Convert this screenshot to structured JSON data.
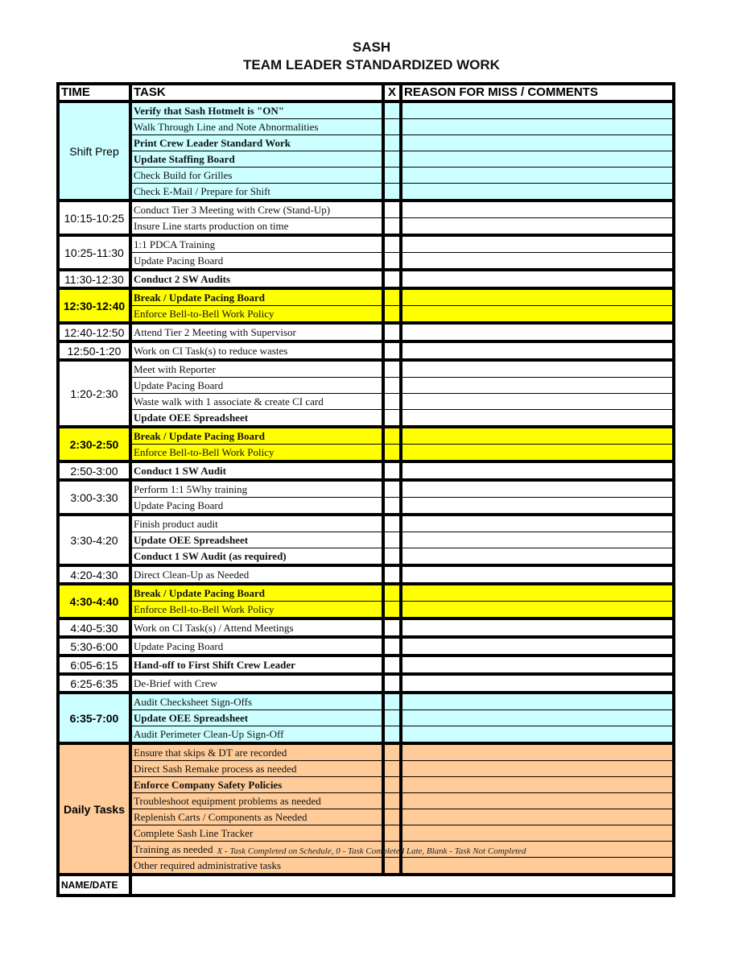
{
  "document": {
    "title": "SASH",
    "subtitle": "TEAM LEADER STANDARDIZED WORK"
  },
  "colors": {
    "cyan": "#ccffff",
    "yellow": "#ffff00",
    "orange": "#ffcc99",
    "white": "#ffffff"
  },
  "headers": {
    "time": "TIME",
    "task": "TASK",
    "x": "X",
    "comments": "REASON FOR MISS / COMMENTS"
  },
  "groups": [
    {
      "time": "Shift Prep",
      "color": "cyan",
      "time_bold": false,
      "tasks": [
        {
          "text": "Verify that Sash Hotmelt is \"ON\"",
          "bold": true
        },
        {
          "text": "Walk Through Line and Note Abnormalities",
          "bold": false
        },
        {
          "text": "Print Crew Leader Standard Work",
          "bold": true
        },
        {
          "text": "Update Staffing Board",
          "bold": true
        },
        {
          "text": "Check Build for Grilles",
          "bold": false
        },
        {
          "text": "Check E-Mail / Prepare for Shift",
          "bold": false
        }
      ]
    },
    {
      "time": "10:15-10:25",
      "color": "white",
      "time_bold": false,
      "tasks": [
        {
          "text": "Conduct Tier 3 Meeting with Crew (Stand-Up)",
          "bold": false
        },
        {
          "text": "Insure Line starts production on time",
          "bold": false
        }
      ]
    },
    {
      "time": "10:25-11:30",
      "color": "white",
      "time_bold": false,
      "tasks": [
        {
          "text": "1:1 PDCA Training",
          "bold": false
        },
        {
          "text": "Update Pacing Board",
          "bold": false
        }
      ]
    },
    {
      "time": "11:30-12:30",
      "color": "white",
      "time_bold": false,
      "tasks": [
        {
          "text": "Conduct 2 SW Audits",
          "bold": true
        }
      ]
    },
    {
      "time": "12:30-12:40",
      "color": "yellow",
      "time_bold": true,
      "tasks": [
        {
          "text": "Break / Update Pacing Board",
          "bold": true
        },
        {
          "text": "Enforce Bell-to-Bell Work Policy",
          "bold": false
        }
      ]
    },
    {
      "time": "12:40-12:50",
      "color": "white",
      "time_bold": false,
      "tasks": [
        {
          "text": "Attend Tier 2 Meeting with Supervisor",
          "bold": false
        }
      ]
    },
    {
      "time": "12:50-1:20",
      "color": "white",
      "time_bold": false,
      "tasks": [
        {
          "text": "Work on CI Task(s) to reduce wastes",
          "bold": false
        }
      ]
    },
    {
      "time": "1:20-2:30",
      "color": "white",
      "time_bold": false,
      "tasks": [
        {
          "text": "Meet with Reporter",
          "bold": false
        },
        {
          "text": "Update Pacing Board",
          "bold": false
        },
        {
          "text": "Waste walk with 1 associate & create CI card",
          "bold": false
        },
        {
          "text": "Update OEE Spreadsheet",
          "bold": true
        }
      ]
    },
    {
      "time": "2:30-2:50",
      "color": "yellow",
      "time_bold": true,
      "tasks": [
        {
          "text": "Break / Update Pacing Board",
          "bold": true
        },
        {
          "text": "Enforce Bell-to-Bell Work Policy",
          "bold": false
        }
      ]
    },
    {
      "time": "2:50-3:00",
      "color": "white",
      "time_bold": false,
      "tasks": [
        {
          "text": "Conduct 1 SW Audit",
          "bold": true
        }
      ]
    },
    {
      "time": "3:00-3:30",
      "color": "white",
      "time_bold": false,
      "tasks": [
        {
          "text": "Perform 1:1 5Why training",
          "bold": false
        },
        {
          "text": "Update Pacing Board",
          "bold": false
        }
      ]
    },
    {
      "time": "3:30-4:20",
      "color": "white",
      "time_bold": false,
      "tasks": [
        {
          "text": "Finish product audit",
          "bold": false
        },
        {
          "text": "Update OEE Spreadsheet",
          "bold": true
        },
        {
          "text": "Conduct 1 SW Audit (as required)",
          "bold": true
        }
      ]
    },
    {
      "time": "4:20-4:30",
      "color": "white",
      "time_bold": false,
      "tasks": [
        {
          "text": "Direct Clean-Up as Needed",
          "bold": false
        }
      ]
    },
    {
      "time": "4:30-4:40",
      "color": "yellow",
      "time_bold": true,
      "tasks": [
        {
          "text": "Break / Update Pacing Board",
          "bold": true
        },
        {
          "text": "Enforce Bell-to-Bell Work Policy",
          "bold": false
        }
      ]
    },
    {
      "time": "4:40-5:30",
      "color": "white",
      "time_bold": false,
      "tasks": [
        {
          "text": "Work on CI Task(s) / Attend Meetings",
          "bold": false
        }
      ]
    },
    {
      "time": "5:30-6:00",
      "color": "white",
      "time_bold": false,
      "tasks": [
        {
          "text": "Update Pacing Board",
          "bold": false
        }
      ]
    },
    {
      "time": "6:05-6:15",
      "color": "white",
      "time_bold": false,
      "tasks": [
        {
          "text": "Hand-off to First Shift Crew Leader",
          "bold": true
        }
      ]
    },
    {
      "time": "6:25-6:35",
      "color": "white",
      "time_bold": false,
      "tasks": [
        {
          "text": "De-Brief with Crew",
          "bold": false
        }
      ]
    },
    {
      "time": "6:35-7:00",
      "color": "cyan",
      "time_bold": true,
      "tasks": [
        {
          "text": "Audit Checksheet Sign-Offs",
          "bold": false
        },
        {
          "text": "Update OEE Spreadsheet",
          "bold": true
        },
        {
          "text": "Audit Perimeter Clean-Up Sign-Off",
          "bold": false
        }
      ]
    },
    {
      "time": "Daily Tasks",
      "color": "orange",
      "time_bold": true,
      "tasks": [
        {
          "text": "Ensure that skips & DT are recorded",
          "bold": false
        },
        {
          "text": "Direct Sash Remake process as needed",
          "bold": false
        },
        {
          "text": "Enforce Company Safety Policies",
          "bold": true
        },
        {
          "text": "Troubleshoot equipment problems as needed",
          "bold": false
        },
        {
          "text": "Replenish Carts / Components as Needed",
          "bold": false
        },
        {
          "text": "Complete Sash Line Tracker",
          "bold": false
        },
        {
          "text": "Training as needed",
          "bold": false
        },
        {
          "text": "Other required administrative tasks",
          "bold": false
        }
      ]
    }
  ],
  "footer": {
    "name_date_label": "NAME/DATE",
    "name_date_value": "",
    "legend": "X - Task Completed on Schedule,  0 - Task Completed Late, Blank - Task Not Completed"
  }
}
